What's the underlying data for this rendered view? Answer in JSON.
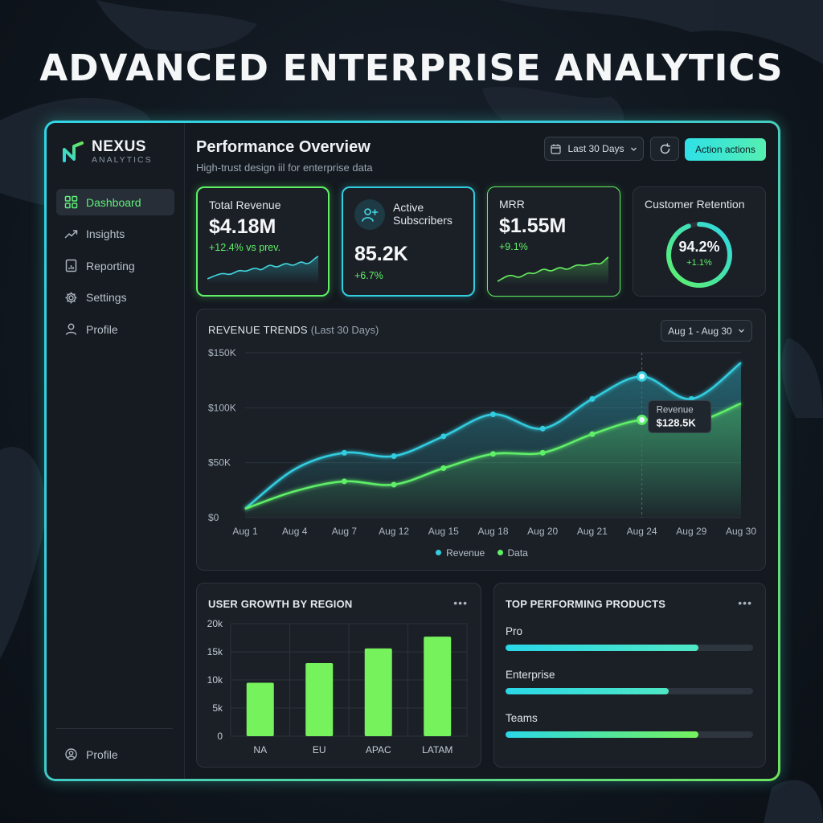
{
  "hero": {
    "title": "ADVANCED ENTERPRISE ANALYTICS"
  },
  "brand": {
    "name": "NEXUS",
    "sub": "ANALYTICS",
    "icon": "nexus-logo-icon"
  },
  "sidebar": {
    "items": [
      {
        "label": "Dashboard",
        "icon": "grid-icon",
        "active": true
      },
      {
        "label": "Insights",
        "icon": "trend-icon",
        "active": false
      },
      {
        "label": "Reporting",
        "icon": "report-icon",
        "active": false
      },
      {
        "label": "Settings",
        "icon": "gear-icon",
        "active": false
      },
      {
        "label": "Profile",
        "icon": "user-icon",
        "active": false
      }
    ],
    "footer_label": "Profile"
  },
  "header": {
    "title": "Performance Overview",
    "subtitle": "High-trust design iil for enterprise data",
    "date_range": "Last 30 Days",
    "action_label": "Action actions"
  },
  "kpis": {
    "revenue": {
      "label": "Total Revenue",
      "value": "$4.18M",
      "delta": "+12.4% vs prev."
    },
    "subscribers": {
      "label_line1": "Active",
      "label_line2": "Subscribers",
      "value": "85.2K",
      "delta": "+6.7%"
    },
    "mrr": {
      "label": "MRR",
      "value": "$1.55M",
      "delta": "+9.1%"
    },
    "retention": {
      "label": "Customer Retention",
      "value": "94.2%",
      "delta": "+1.1%",
      "fraction": 0.942
    }
  },
  "trends": {
    "title": "REVENUE TRENDS",
    "title_suffix": "(Last 30 Days)",
    "range_label": "Aug 1 - Aug 30",
    "tooltip": {
      "label": "Revenue",
      "value": "$128.5K"
    },
    "legend": [
      "Revenue",
      "Data"
    ]
  },
  "regions": {
    "title": "USER GROWTH BY REGION"
  },
  "products": {
    "title": "TOP PERFORMING PRODUCTS",
    "items": [
      {
        "label": "Pro",
        "share": 0.78
      },
      {
        "label": "Enterprise",
        "share": 0.66
      },
      {
        "label": "Teams",
        "share": 0.78
      }
    ]
  },
  "colors": {
    "accent_cyan": "#33cde0",
    "accent_green": "#5ff067",
    "background": "#14191f"
  },
  "chart_data": [
    {
      "type": "line",
      "title": "REVENUE TRENDS (Last 30 Days)",
      "x": [
        "Aug 1",
        "Aug 4",
        "Aug 7",
        "Aug 12",
        "Aug 15",
        "Aug 18",
        "Aug 20",
        "Aug 21",
        "Aug 24",
        "Aug 29",
        "Aug 30"
      ],
      "y_ticks": [
        "$0",
        "$50K",
        "$100K",
        "$150K"
      ],
      "ylim": [
        0,
        150000
      ],
      "series": [
        {
          "name": "Revenue",
          "values": [
            8000,
            44000,
            59000,
            56000,
            74000,
            94000,
            81000,
            108000,
            128500,
            108000,
            141000
          ],
          "color": "#33cde0"
        },
        {
          "name": "Data",
          "values": [
            8000,
            24000,
            33000,
            30000,
            45000,
            58000,
            59000,
            76000,
            89000,
            86000,
            104000
          ],
          "color": "#5ff067"
        }
      ],
      "highlight_index": 8,
      "grid": true,
      "legend_position": "bottom"
    },
    {
      "type": "bar",
      "title": "USER GROWTH BY REGION",
      "categories": [
        "NA",
        "EU",
        "APAC",
        "LATAM"
      ],
      "values": [
        9500,
        13000,
        15600,
        17700
      ],
      "y_ticks": [
        "0",
        "5k",
        "10k",
        "15k",
        "20k"
      ],
      "ylim": [
        0,
        20000
      ],
      "grid": true,
      "color": "#76f35c"
    }
  ]
}
